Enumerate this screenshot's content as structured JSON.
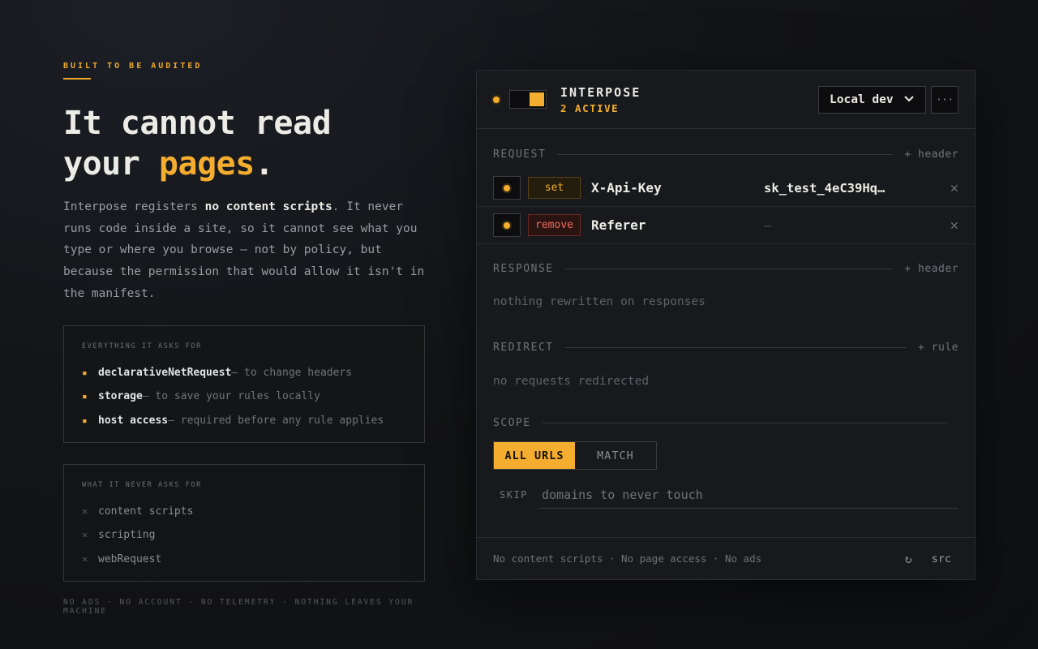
{
  "hero": {
    "eyebrow": "BUILT TO BE AUDITED",
    "headline_1": "It cannot read",
    "headline_2a": "your ",
    "headline_accent": "pages",
    "headline_2b": ".",
    "lede_1": "Interpose registers ",
    "lede_bold": "no content scripts",
    "lede_2": ". It never runs code inside a site, so it cannot see what you type or where you browse — not by policy, but because the permission that would allow it isn't in the manifest."
  },
  "asks": {
    "title": "EVERYTHING IT ASKS FOR",
    "items": [
      {
        "name": "declarativeNetRequest",
        "desc": " — to change headers"
      },
      {
        "name": "storage",
        "desc": " — to save your rules locally"
      },
      {
        "name": "host access",
        "desc": " — required before any rule applies"
      }
    ]
  },
  "never": {
    "title": "WHAT IT NEVER ASKS FOR",
    "items": [
      "content scripts",
      "scripting",
      "webRequest"
    ]
  },
  "footer_note": "NO ADS · NO ACCOUNT · NO TELEMETRY · NOTHING LEAVES YOUR MACHINE",
  "panel": {
    "brand": "INTERPOSE",
    "active": "2 ACTIVE",
    "env": "Local dev",
    "more": "···",
    "request": {
      "label": "REQUEST",
      "add": "+ header",
      "rules": [
        {
          "op": "set",
          "name": "X-Api-Key",
          "value": "sk_test_4eC39Hq…"
        },
        {
          "op": "remove",
          "name": "Referer",
          "value": "—"
        }
      ]
    },
    "response": {
      "label": "RESPONSE",
      "add": "+ header",
      "empty": "nothing rewritten on responses"
    },
    "redirect": {
      "label": "REDIRECT",
      "add": "+ rule",
      "empty": "no requests redirected"
    },
    "scope": {
      "label": "SCOPE",
      "tabs": [
        "ALL URLS",
        "MATCH"
      ],
      "skip_label": "SKIP",
      "skip_placeholder": "domains to never touch"
    },
    "footer": {
      "note": "No content scripts · No page access · No ads",
      "refresh": "↻",
      "src": "src"
    }
  },
  "colors": {
    "accent": "#f4ad2e",
    "danger": "#ef6a5a",
    "bg": "#131417"
  }
}
